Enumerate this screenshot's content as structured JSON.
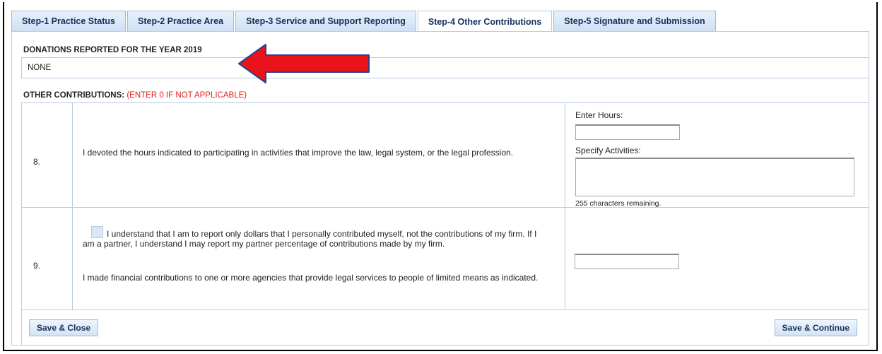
{
  "tabs": [
    {
      "label": "Step-1 Practice Status"
    },
    {
      "label": "Step-2 Practice Area"
    },
    {
      "label": "Step-3 Service and Support Reporting"
    },
    {
      "label": "Step-4 Other Contributions",
      "active": true
    },
    {
      "label": "Step-5 Signature and Submission"
    }
  ],
  "donations": {
    "heading": "DONATIONS REPORTED FOR THE YEAR 2019",
    "value": "NONE"
  },
  "other": {
    "heading": "OTHER CONTRIBUTIONS:",
    "note": "(ENTER 0 IF NOT APPLICABLE)"
  },
  "rows": [
    {
      "number": "8.",
      "statement": "I devoted the hours indicated to participating in activities that improve the law, legal system, or the legal profession.",
      "hours_label": "Enter Hours:",
      "hours_value": "",
      "activities_label": "Specify Activities:",
      "activities_value": "",
      "remaining": "255 characters remaining."
    },
    {
      "number": "9.",
      "checkbox_text": "I understand that I am to report only dollars that I personally contributed myself, not the contributions of my firm. If I am a partner, I understand I may report my partner percentage of contributions made by my firm.",
      "checkbox_checked": false,
      "statement": "I made financial contributions to one or more agencies that provide legal services to people of limited means as indicated.",
      "amount_value": ""
    }
  ],
  "buttons": {
    "save_close": "Save & Close",
    "save_continue": "Save & Continue"
  },
  "colors": {
    "tab_text": "#14305a",
    "border": "#b6cde3",
    "warning": "#e0201a",
    "annotation_arrow_fill": "#e8131b",
    "annotation_arrow_stroke": "#2b3f8f"
  }
}
